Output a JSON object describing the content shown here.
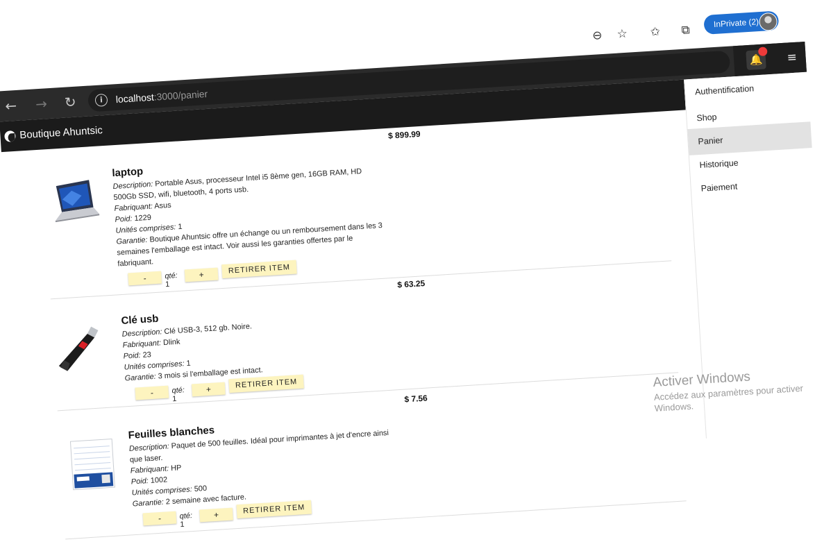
{
  "browser": {
    "inprivate_label": "InPrivate (2)",
    "url_host": "localhost",
    "url_path": ":3000/panier"
  },
  "app": {
    "title": "Boutique Ahuntsic"
  },
  "nav": {
    "items": [
      {
        "label": "Authentification",
        "active": false
      },
      {
        "label": "Shop",
        "active": false
      },
      {
        "label": "Panier",
        "active": true
      },
      {
        "label": "Historique",
        "active": false
      },
      {
        "label": "Paiement",
        "active": false
      }
    ]
  },
  "labels": {
    "description": "Description:",
    "manufacturer": "Fabriquant:",
    "weight": "Poid:",
    "units": "Unités comprises:",
    "warranty": "Garantie:",
    "qty": "qté:",
    "minus": "-",
    "plus": "+",
    "remove": "RETIRER ITEM"
  },
  "products": [
    {
      "name": "laptop",
      "price": "$ 899.99",
      "description": "Portable Asus, processeur Intel i5 8ème gen, 16GB RAM, HD 500Gb SSD, wifi, bluetooth, 4 ports usb.",
      "manufacturer": "Asus",
      "weight": "1229",
      "units": "1",
      "warranty": "Boutique Ahuntsic offre un échange ou un remboursement dans les 3 semaines l'emballage est intact. Voir aussi les garanties offertes par le fabriquant.",
      "qty": "1"
    },
    {
      "name": "Clé usb",
      "price": "$ 63.25",
      "description": "Clé USB-3, 512 gb. Noire.",
      "manufacturer": "Dlink",
      "weight": "23",
      "units": "1",
      "warranty": "3 mois si l'emballage est intact.",
      "qty": "1"
    },
    {
      "name": "Feuilles blanches",
      "price": "$ 7.56",
      "description": "Paquet de 500 feuilles. Idéal pour imprimantes à jet d'encre ainsi que laser.",
      "manufacturer": "HP",
      "weight": "1002",
      "units": "500",
      "warranty": "2 semaine avec facture.",
      "qty": "1"
    }
  ],
  "watermark": {
    "title": "Activer Windows",
    "text": "Accédez aux paramètres pour activer Windows."
  }
}
